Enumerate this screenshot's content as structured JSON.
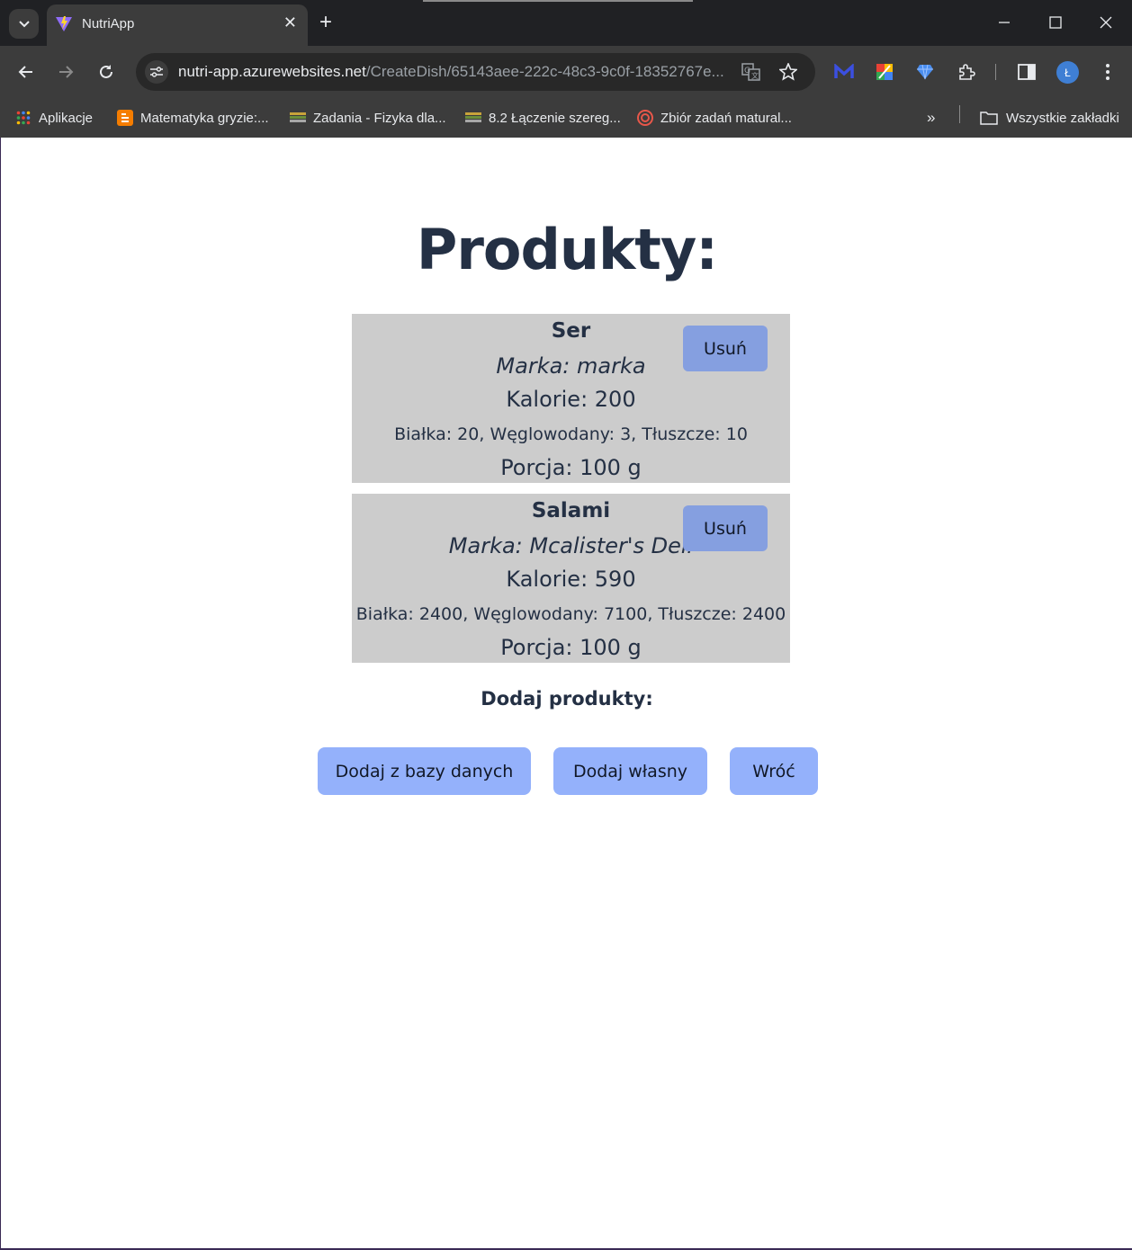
{
  "browser": {
    "tab_title": "NutriApp",
    "url_domain": "nutri-app.azurewebsites.net",
    "url_path": "/CreateDish/65143aee-222c-48c3-9c0f-18352767e...",
    "bookmarks": [
      {
        "label": "Aplikacje",
        "icon": "apps-grid-icon"
      },
      {
        "label": "Matematyka gryzie:...",
        "icon": "blogger-icon"
      },
      {
        "label": "Zadania - Fizyka dla...",
        "icon": "books-icon"
      },
      {
        "label": "8.2 Łączenie szereg...",
        "icon": "books-icon"
      },
      {
        "label": "Zbiór zadań matural...",
        "icon": "target-icon"
      }
    ],
    "all_bookmarks_label": "Wszystkie zakładki",
    "profile_initial": "Ł"
  },
  "page": {
    "title": "Produkty:",
    "products": [
      {
        "name": "Ser",
        "brand": "Marka: marka",
        "calories": "Kalorie: 200",
        "macros": "Białka: 20, Węglowodany: 3, Tłuszcze: 10",
        "portion": "Porcja: 100 g",
        "remove_label": "Usuń"
      },
      {
        "name": "Salami",
        "brand": "Marka: Mcalister's Deli",
        "calories": "Kalorie: 590",
        "macros": "Białka: 2400, Węglowodany: 7100, Tłuszcze: 2400",
        "portion": "Porcja: 100 g",
        "remove_label": "Usuń"
      }
    ],
    "add_heading": "Dodaj produkty:",
    "buttons": {
      "add_from_db": "Dodaj z bazy danych",
      "add_custom": "Dodaj własny",
      "back": "Wróć"
    }
  }
}
